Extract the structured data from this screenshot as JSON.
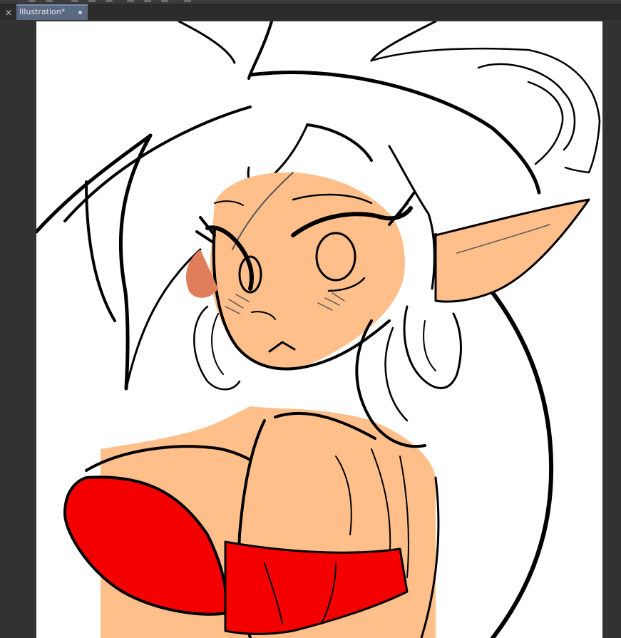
{
  "app": {
    "document_tab": {
      "title": "Illustration*",
      "close_icon": "close-icon",
      "modified_indicator": "unsaved-dot-icon"
    }
  },
  "colors": {
    "workspace_bg": "#323232",
    "tab_active": "#5b6a83",
    "canvas_bg": "#ffffff",
    "skin": "#ffbf8b",
    "skin_shadow": "#e07d5a",
    "top_red": "#f50000",
    "lineart": "#000000"
  },
  "toolbar": {
    "icons": [
      "tool-icon",
      "tool-icon",
      "tool-icon",
      "tool-icon",
      "tool-icon",
      "tool-icon",
      "tool-icon",
      "tool-icon",
      "tool-icon"
    ]
  }
}
